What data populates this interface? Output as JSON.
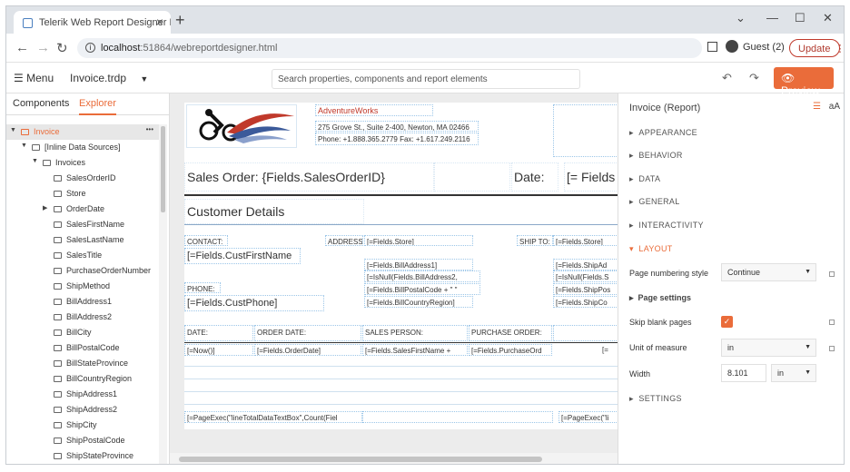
{
  "browser": {
    "tab_title": "Telerik Web Report Designer Der",
    "new_tab": "+",
    "url_host": "localhost",
    "url_path": ":51864/webreportdesigner.html",
    "profile_label": "Guest (2)",
    "update_label": "Update"
  },
  "toolbar": {
    "menu_label": "Menu",
    "doc_name": "Invoice.trdp",
    "search_placeholder": "Search properties, components and report elements",
    "preview_label": "Preview"
  },
  "left_panel": {
    "tabs": [
      "Components",
      "Explorer"
    ],
    "active_tab": "Explorer",
    "tree": [
      {
        "label": "Invoice",
        "level": 0,
        "selected": true
      },
      {
        "label": "[Inline Data Sources]",
        "level": 1
      },
      {
        "label": "Invoices",
        "level": 2
      },
      {
        "label": "SalesOrderID",
        "level": 3
      },
      {
        "label": "Store",
        "level": 3
      },
      {
        "label": "OrderDate",
        "level": 3
      },
      {
        "label": "SalesFirstName",
        "level": 3
      },
      {
        "label": "SalesLastName",
        "level": 3
      },
      {
        "label": "SalesTitle",
        "level": 3
      },
      {
        "label": "PurchaseOrderNumber",
        "level": 3
      },
      {
        "label": "ShipMethod",
        "level": 3
      },
      {
        "label": "BillAddress1",
        "level": 3
      },
      {
        "label": "BillAddress2",
        "level": 3
      },
      {
        "label": "BillCity",
        "level": 3
      },
      {
        "label": "BillPostalCode",
        "level": 3
      },
      {
        "label": "BillStateProvince",
        "level": 3
      },
      {
        "label": "BillCountryRegion",
        "level": 3
      },
      {
        "label": "ShipAddress1",
        "level": 3
      },
      {
        "label": "ShipAddress2",
        "level": 3
      },
      {
        "label": "ShipCity",
        "level": 3
      },
      {
        "label": "ShipPostalCode",
        "level": 3
      },
      {
        "label": "ShipStateProvince",
        "level": 3
      }
    ]
  },
  "report": {
    "company": "AdventureWorks",
    "address_line": "275 Grove St., Suite 2-400, Newton, MA 02466",
    "phone_line": "Phone: +1.888.365.2779 Fax: +1.617.249.2116",
    "sales_order": "Sales Order: {Fields.SalesOrderID}",
    "date_label": "Date:",
    "date_field": "[= Fields",
    "customer_details": "Customer Details",
    "contact_label": "CONTACT:",
    "contact_field": "[=Fields.CustFirstName",
    "address_label": "ADDRESS:",
    "store_field": "[=Fields.Store]",
    "ship_to_label": "SHIP TO:",
    "ship_store_field": "[=Fields.Store]",
    "bill_address1": "[=Fields.BillAddress1]",
    "bill_address2": "[=IsNull(Fields.BillAddress2,",
    "bill_postal": "[=Fields.BillPostalCode + \" \"",
    "bill_country": "[=Fields.BillCountryRegion]",
    "ship_address1": "[=Fields.ShipAd",
    "ship_address2": "[=IsNull(Fields.S",
    "ship_postal": "[=Fields.ShipPos",
    "ship_country": "[=Fields.ShipCo",
    "phone_label": "PHONE:",
    "phone_field": "[=Fields.CustPhone]",
    "col_date": "DATE:",
    "col_order_date": "ORDER DATE:",
    "col_sales_person": "SALES PERSON:",
    "col_purchase_order": "PURCHASE ORDER:",
    "val_now": "[=Now()]",
    "val_order_date": "[=Fields.OrderDate]",
    "val_sales_first": "[=Fields.SalesFirstName +",
    "val_purchase_order": "[=Fields.PurchaseOrd",
    "val_trailing": "[=",
    "footer_left": "[=PageExec(\"lineTotalDataTextBox\",Count(Fiel",
    "footer_right": "[=PageExec(\"li"
  },
  "right_panel": {
    "title": "Invoice (Report)",
    "icon_text": "aA",
    "sections": [
      "APPEARANCE",
      "BEHAVIOR",
      "DATA",
      "GENERAL",
      "INTERACTIVITY",
      "LAYOUT"
    ],
    "page_numbering_label": "Page numbering style",
    "page_numbering_value": "Continue",
    "page_settings_label": "Page settings",
    "skip_blank_label": "Skip blank pages",
    "skip_blank_checked": true,
    "unit_label": "Unit of measure",
    "unit_value": "in",
    "width_label": "Width",
    "width_value": "8.101",
    "width_unit": "in",
    "settings_section": "SETTINGS"
  },
  "colors": {
    "accent": "#ea6c3a",
    "selection": "#e7e7e7"
  }
}
